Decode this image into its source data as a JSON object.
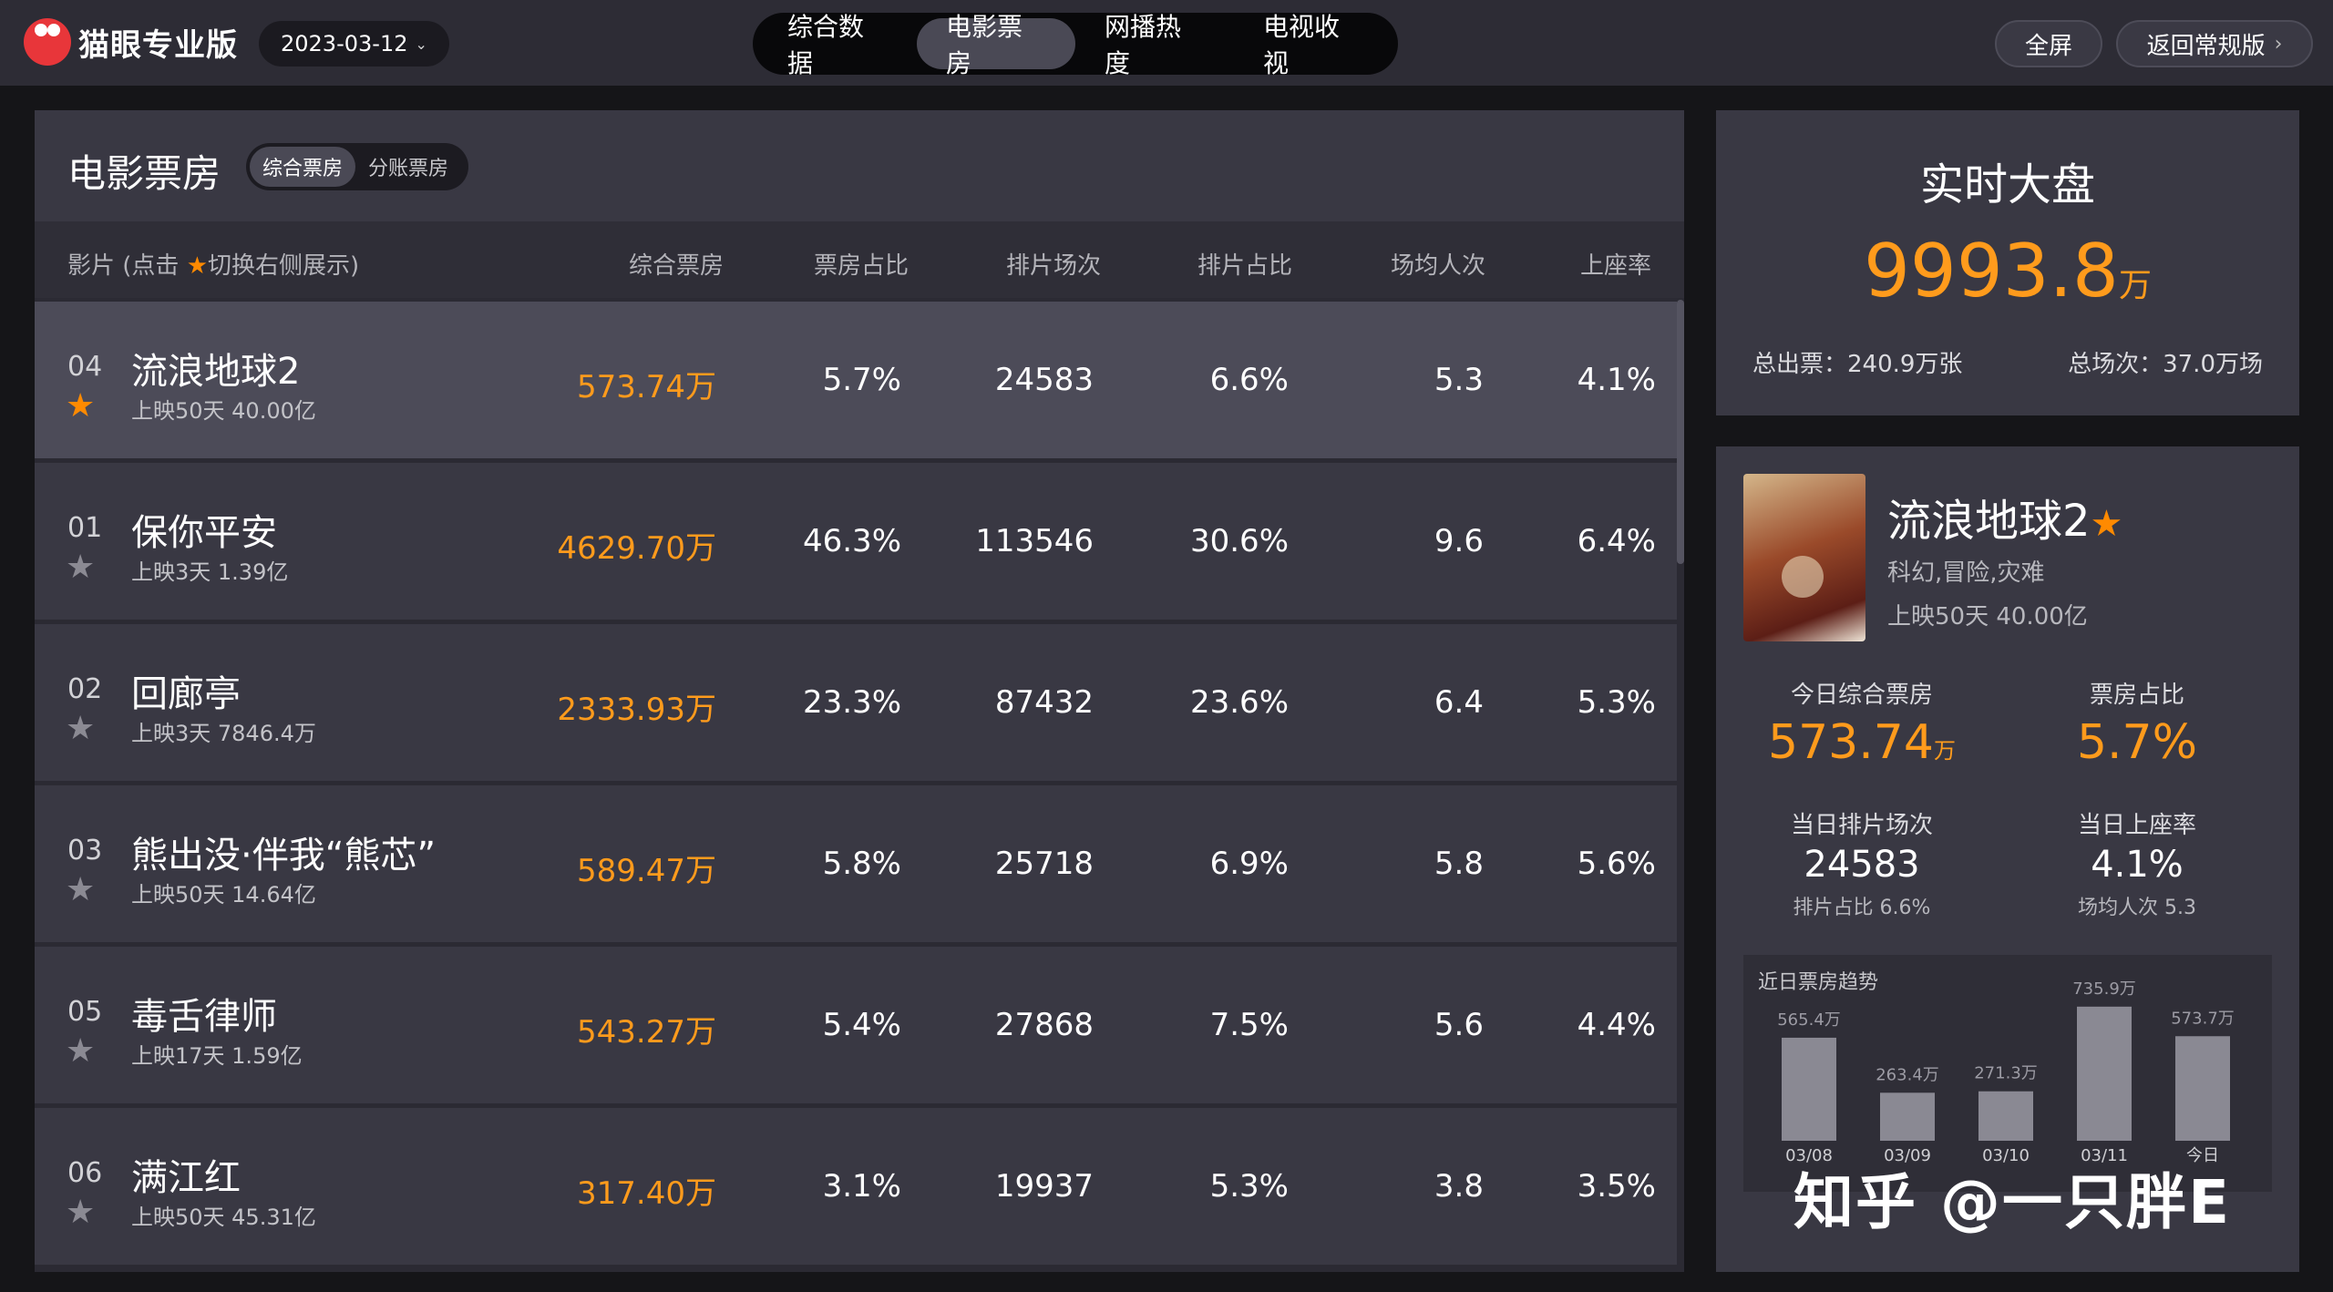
{
  "app": {
    "brand": "猫眼专业版",
    "date": "2023-03-12"
  },
  "nav": {
    "tabs": [
      "综合数据",
      "电影票房",
      "网播热度",
      "电视收视"
    ],
    "active": 1
  },
  "header_buttons": {
    "fullscreen": "全屏",
    "back": "返回常规版"
  },
  "main": {
    "title": "电影票房",
    "seg": [
      "综合票房",
      "分账票房"
    ],
    "columns": {
      "film_pre": "影片 (点击",
      "film_post": "切换右侧展示)",
      "box": "综合票房",
      "box_ratio": "票房占比",
      "shows": "排片场次",
      "show_ratio": "排片占比",
      "avg": "场均人次",
      "seat": "上座率"
    },
    "rows": [
      {
        "rank": "04",
        "name": "流浪地球2",
        "sub": "上映50天  40.00亿",
        "box": "573.74万",
        "box_ratio": "5.7%",
        "shows": "24583",
        "show_ratio": "6.6%",
        "avg": "5.3",
        "seat": "4.1%",
        "starred": true
      },
      {
        "rank": "01",
        "name": "保你平安",
        "sub": "上映3天  1.39亿",
        "box": "4629.70万",
        "box_ratio": "46.3%",
        "shows": "113546",
        "show_ratio": "30.6%",
        "avg": "9.6",
        "seat": "6.4%",
        "starred": false
      },
      {
        "rank": "02",
        "name": "回廊亭",
        "sub": "上映3天  7846.4万",
        "box": "2333.93万",
        "box_ratio": "23.3%",
        "shows": "87432",
        "show_ratio": "23.6%",
        "avg": "6.4",
        "seat": "5.3%",
        "starred": false
      },
      {
        "rank": "03",
        "name": "熊出没·伴我“熊芯”",
        "sub": "上映50天  14.64亿",
        "box": "589.47万",
        "box_ratio": "5.8%",
        "shows": "25718",
        "show_ratio": "6.9%",
        "avg": "5.8",
        "seat": "5.6%",
        "starred": false
      },
      {
        "rank": "05",
        "name": "毒舌律师",
        "sub": "上映17天  1.59亿",
        "box": "543.27万",
        "box_ratio": "5.4%",
        "shows": "27868",
        "show_ratio": "7.5%",
        "avg": "5.6",
        "seat": "4.4%",
        "starred": false
      },
      {
        "rank": "06",
        "name": "满江红",
        "sub": "上映50天  45.31亿",
        "box": "317.40万",
        "box_ratio": "3.1%",
        "shows": "19937",
        "show_ratio": "5.3%",
        "avg": "3.8",
        "seat": "3.5%",
        "starred": false
      }
    ]
  },
  "realtime": {
    "title": "实时大盘",
    "value": "9993.8",
    "unit": "万",
    "tickets": "总出票：240.9万张",
    "shows": "总场次：37.0万场"
  },
  "detail": {
    "name": "流浪地球2",
    "genre": "科幻,冒险,灾难",
    "days": "上映50天  40.00亿",
    "today_box_label": "今日综合票房",
    "today_box": "573.74",
    "today_box_unit": "万",
    "ratio_label": "票房占比",
    "ratio": "5.7%",
    "shows_label": "当日排片场次",
    "shows": "24583",
    "shows_sub": "排片占比 6.6%",
    "seat_label": "当日上座率",
    "seat": "4.1%",
    "seat_sub": "场均人次 5.3"
  },
  "chart_data": {
    "type": "bar",
    "title": "近日票房趋势",
    "categories": [
      "03/08",
      "03/09",
      "03/10",
      "03/11",
      "今日"
    ],
    "values": [
      565.4,
      263.4,
      271.3,
      735.9,
      573.7
    ],
    "labels": [
      "565.4万",
      "263.4万",
      "271.3万",
      "735.9万",
      "573.7万"
    ],
    "color": "#8a8993"
  },
  "watermark": "知乎 @一只胖E",
  "colors": {
    "accent": "#ff9b1c",
    "panel": "#393843",
    "bg": "#151518"
  }
}
